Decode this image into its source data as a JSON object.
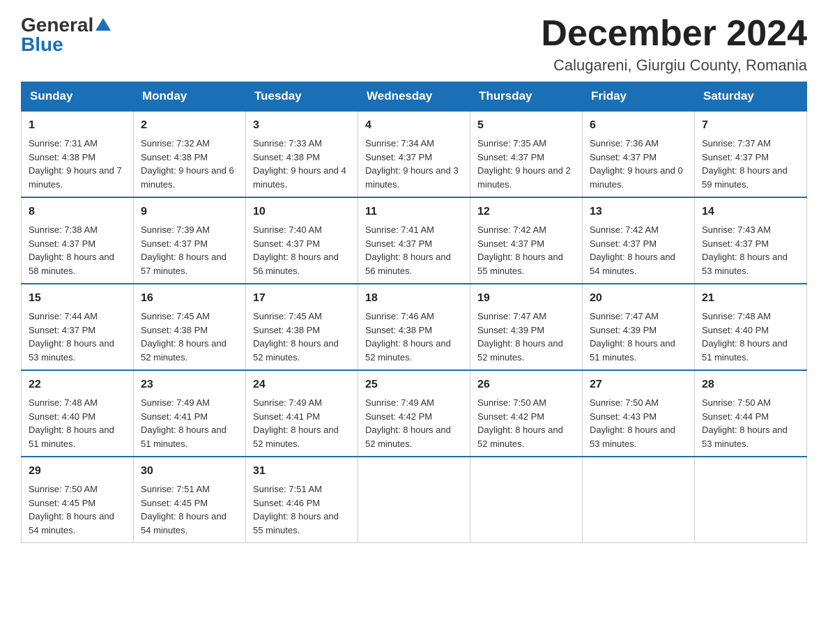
{
  "header": {
    "logo_general": "General",
    "logo_blue": "Blue",
    "month_title": "December 2024",
    "location": "Calugareni, Giurgiu County, Romania"
  },
  "weekdays": [
    "Sunday",
    "Monday",
    "Tuesday",
    "Wednesday",
    "Thursday",
    "Friday",
    "Saturday"
  ],
  "weeks": [
    [
      {
        "day": "1",
        "sunrise": "Sunrise: 7:31 AM",
        "sunset": "Sunset: 4:38 PM",
        "daylight": "Daylight: 9 hours and 7 minutes."
      },
      {
        "day": "2",
        "sunrise": "Sunrise: 7:32 AM",
        "sunset": "Sunset: 4:38 PM",
        "daylight": "Daylight: 9 hours and 6 minutes."
      },
      {
        "day": "3",
        "sunrise": "Sunrise: 7:33 AM",
        "sunset": "Sunset: 4:38 PM",
        "daylight": "Daylight: 9 hours and 4 minutes."
      },
      {
        "day": "4",
        "sunrise": "Sunrise: 7:34 AM",
        "sunset": "Sunset: 4:37 PM",
        "daylight": "Daylight: 9 hours and 3 minutes."
      },
      {
        "day": "5",
        "sunrise": "Sunrise: 7:35 AM",
        "sunset": "Sunset: 4:37 PM",
        "daylight": "Daylight: 9 hours and 2 minutes."
      },
      {
        "day": "6",
        "sunrise": "Sunrise: 7:36 AM",
        "sunset": "Sunset: 4:37 PM",
        "daylight": "Daylight: 9 hours and 0 minutes."
      },
      {
        "day": "7",
        "sunrise": "Sunrise: 7:37 AM",
        "sunset": "Sunset: 4:37 PM",
        "daylight": "Daylight: 8 hours and 59 minutes."
      }
    ],
    [
      {
        "day": "8",
        "sunrise": "Sunrise: 7:38 AM",
        "sunset": "Sunset: 4:37 PM",
        "daylight": "Daylight: 8 hours and 58 minutes."
      },
      {
        "day": "9",
        "sunrise": "Sunrise: 7:39 AM",
        "sunset": "Sunset: 4:37 PM",
        "daylight": "Daylight: 8 hours and 57 minutes."
      },
      {
        "day": "10",
        "sunrise": "Sunrise: 7:40 AM",
        "sunset": "Sunset: 4:37 PM",
        "daylight": "Daylight: 8 hours and 56 minutes."
      },
      {
        "day": "11",
        "sunrise": "Sunrise: 7:41 AM",
        "sunset": "Sunset: 4:37 PM",
        "daylight": "Daylight: 8 hours and 56 minutes."
      },
      {
        "day": "12",
        "sunrise": "Sunrise: 7:42 AM",
        "sunset": "Sunset: 4:37 PM",
        "daylight": "Daylight: 8 hours and 55 minutes."
      },
      {
        "day": "13",
        "sunrise": "Sunrise: 7:42 AM",
        "sunset": "Sunset: 4:37 PM",
        "daylight": "Daylight: 8 hours and 54 minutes."
      },
      {
        "day": "14",
        "sunrise": "Sunrise: 7:43 AM",
        "sunset": "Sunset: 4:37 PM",
        "daylight": "Daylight: 8 hours and 53 minutes."
      }
    ],
    [
      {
        "day": "15",
        "sunrise": "Sunrise: 7:44 AM",
        "sunset": "Sunset: 4:37 PM",
        "daylight": "Daylight: 8 hours and 53 minutes."
      },
      {
        "day": "16",
        "sunrise": "Sunrise: 7:45 AM",
        "sunset": "Sunset: 4:38 PM",
        "daylight": "Daylight: 8 hours and 52 minutes."
      },
      {
        "day": "17",
        "sunrise": "Sunrise: 7:45 AM",
        "sunset": "Sunset: 4:38 PM",
        "daylight": "Daylight: 8 hours and 52 minutes."
      },
      {
        "day": "18",
        "sunrise": "Sunrise: 7:46 AM",
        "sunset": "Sunset: 4:38 PM",
        "daylight": "Daylight: 8 hours and 52 minutes."
      },
      {
        "day": "19",
        "sunrise": "Sunrise: 7:47 AM",
        "sunset": "Sunset: 4:39 PM",
        "daylight": "Daylight: 8 hours and 52 minutes."
      },
      {
        "day": "20",
        "sunrise": "Sunrise: 7:47 AM",
        "sunset": "Sunset: 4:39 PM",
        "daylight": "Daylight: 8 hours and 51 minutes."
      },
      {
        "day": "21",
        "sunrise": "Sunrise: 7:48 AM",
        "sunset": "Sunset: 4:40 PM",
        "daylight": "Daylight: 8 hours and 51 minutes."
      }
    ],
    [
      {
        "day": "22",
        "sunrise": "Sunrise: 7:48 AM",
        "sunset": "Sunset: 4:40 PM",
        "daylight": "Daylight: 8 hours and 51 minutes."
      },
      {
        "day": "23",
        "sunrise": "Sunrise: 7:49 AM",
        "sunset": "Sunset: 4:41 PM",
        "daylight": "Daylight: 8 hours and 51 minutes."
      },
      {
        "day": "24",
        "sunrise": "Sunrise: 7:49 AM",
        "sunset": "Sunset: 4:41 PM",
        "daylight": "Daylight: 8 hours and 52 minutes."
      },
      {
        "day": "25",
        "sunrise": "Sunrise: 7:49 AM",
        "sunset": "Sunset: 4:42 PM",
        "daylight": "Daylight: 8 hours and 52 minutes."
      },
      {
        "day": "26",
        "sunrise": "Sunrise: 7:50 AM",
        "sunset": "Sunset: 4:42 PM",
        "daylight": "Daylight: 8 hours and 52 minutes."
      },
      {
        "day": "27",
        "sunrise": "Sunrise: 7:50 AM",
        "sunset": "Sunset: 4:43 PM",
        "daylight": "Daylight: 8 hours and 53 minutes."
      },
      {
        "day": "28",
        "sunrise": "Sunrise: 7:50 AM",
        "sunset": "Sunset: 4:44 PM",
        "daylight": "Daylight: 8 hours and 53 minutes."
      }
    ],
    [
      {
        "day": "29",
        "sunrise": "Sunrise: 7:50 AM",
        "sunset": "Sunset: 4:45 PM",
        "daylight": "Daylight: 8 hours and 54 minutes."
      },
      {
        "day": "30",
        "sunrise": "Sunrise: 7:51 AM",
        "sunset": "Sunset: 4:45 PM",
        "daylight": "Daylight: 8 hours and 54 minutes."
      },
      {
        "day": "31",
        "sunrise": "Sunrise: 7:51 AM",
        "sunset": "Sunset: 4:46 PM",
        "daylight": "Daylight: 8 hours and 55 minutes."
      },
      null,
      null,
      null,
      null
    ]
  ]
}
